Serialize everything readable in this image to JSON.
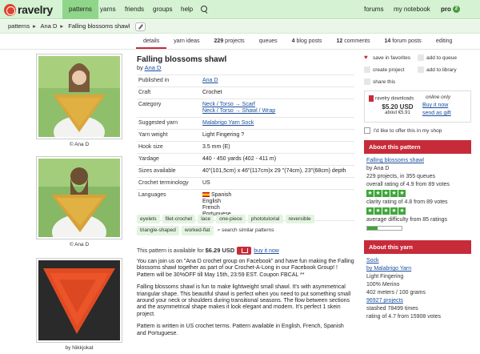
{
  "nav": {
    "logo": "ravelry",
    "items": [
      "patterns",
      "yarns",
      "friends",
      "groups",
      "help"
    ],
    "right": [
      "forums",
      "my notebook"
    ],
    "pro": "pro",
    "pro_badge": "2"
  },
  "breadcrumb": {
    "items": [
      "patterns",
      "Ana D",
      "Falling blossoms shawl"
    ]
  },
  "tabs": [
    {
      "label": "details"
    },
    {
      "label": "yarn ideas"
    },
    {
      "count": "229",
      "label": "projects"
    },
    {
      "label": "queues"
    },
    {
      "count": "4",
      "label": "blog posts"
    },
    {
      "count": "12",
      "label": "comments"
    },
    {
      "count": "14",
      "label": "forum posts"
    },
    {
      "label": "editing"
    }
  ],
  "photos": [
    {
      "caption": "© Ana D"
    },
    {
      "caption": "© Ana D"
    },
    {
      "caption": "by Nikkjokat"
    }
  ],
  "pattern": {
    "title": "Falling blossoms shawl",
    "by": "by",
    "designer": "Ana D",
    "attributes": [
      {
        "key": "Published in",
        "value": "Ana D"
      },
      {
        "key": "Craft",
        "value": "Crochet"
      },
      {
        "key": "Category",
        "value": "Neck / Torso → Scarf",
        "value2": "Neck / Torso → Shawl / Wrap"
      },
      {
        "key": "Suggested yarn",
        "value": "Malabrigo Yarn Sock"
      },
      {
        "key": "Yarn weight",
        "value": "Light Fingering ?"
      },
      {
        "key": "Hook size",
        "value": "3.5 mm (E)"
      },
      {
        "key": "Yardage",
        "value": "440 - 450 yards (402 - 411 m)"
      },
      {
        "key": "Sizes available",
        "value": "40\"(101,5cm) x 46\"(117cm)x 29 \"(74cm), 23\"(68cm) depth"
      },
      {
        "key": "Crochet terminology",
        "value": "US"
      },
      {
        "key": "Languages",
        "value": "Spanish",
        "value2": "English",
        "value3": "French",
        "value4": "Portuguese"
      }
    ],
    "tags": [
      "eyelets",
      "filet-crochet",
      "lace",
      "one-piece",
      "phototutorial",
      "reversible",
      "triangle-shaped",
      "worked-flat"
    ],
    "similar": "search similar patterns",
    "price_text": "This pattern is available for",
    "price": "$6.29 USD",
    "buy": "buy it now",
    "desc": [
      "You can join us on \"Ana D crochet group on Facebook\" and have fun making the Falling blossoms shawl together as part of our Crochet-A-Long in our Facebook Group! ! Pattern will be 30%OFF till May 15th, 23:59 EST. Coupon FBCAL **",
      "Falling blossoms shawl is fun to make lightweight small shawl. It's with asymmetrical triangular shape. This beautiful shawl is perfect when you need to put something small around your neck or shoulders during transitional seasons. The flow between sections and the asymmetrical shape makes it look elegant and modern. It's perfect 1 skein project.",
      "Pattern is written in US crochet terms. Pattern available in English, French, Spanish and Portuguese."
    ]
  },
  "actions": {
    "favorites": "save in favorites",
    "queue": "add to queue",
    "project": "create project",
    "library": "add to library",
    "share": "share this"
  },
  "purchase": {
    "downloads": "ravelry downloads",
    "online": "online only",
    "price": "$5.20 USD",
    "about": "about €5.91",
    "buy": "Buy it now",
    "gift": "send as gift",
    "offer": "I'd like to offer this in my shop"
  },
  "about_pattern": {
    "header": "About this pattern",
    "name": "Falling blossoms shawl",
    "by": "by Ana D",
    "projects": "229 projects, in 355 queues",
    "rating": "overall rating of 4.9 from 89 votes",
    "rating_value": 4.9,
    "clarity": "clarity rating of 4.8 from 89 votes",
    "clarity_value": 4.8,
    "difficulty": "average difficulty from 85 ratings",
    "difficulty_fraction": 0.3
  },
  "about_yarn": {
    "header": "About this yarn",
    "name": "Sock",
    "by": "by Malabrigo Yarn",
    "weight": "Light Fingering",
    "fiber": "100% Merino",
    "meters": "402 meters / 100 grams",
    "projects": "96927 projects",
    "stashed": "stashed 78499 times",
    "rating": "rating of 4.7 from 15908 votes",
    "rating_value": 4.7
  }
}
